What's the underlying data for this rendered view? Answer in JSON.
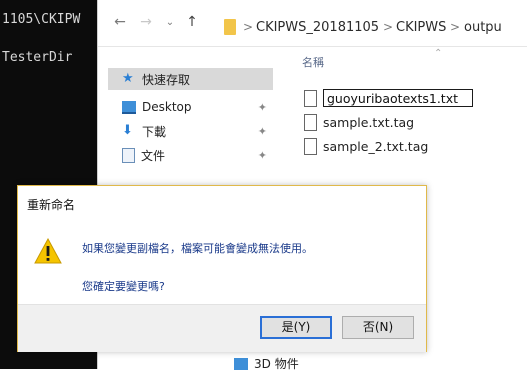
{
  "console": {
    "line1": "1105\\CKIPW",
    "line2": "TesterDir"
  },
  "address": {
    "back_icon": "back-arrow-icon",
    "forward_icon": "forward-arrow-icon",
    "dropdown_icon": "chevron-down-icon",
    "up_icon": "up-arrow-icon",
    "separator": ">",
    "crumbs": [
      "CKIPWS_20181105",
      "CKIPWS",
      "outpu"
    ]
  },
  "navpane": {
    "items": [
      {
        "label": "快速存取",
        "icon": "star-icon",
        "pinned": false
      },
      {
        "label": "Desktop",
        "icon": "desktop-folder-icon",
        "pinned": true
      },
      {
        "label": "下載",
        "icon": "download-folder-icon",
        "pinned": true
      },
      {
        "label": "文件",
        "icon": "documents-folder-icon",
        "pinned": true
      }
    ],
    "bottom_item": "3D 物件",
    "pin_glyph": "✦"
  },
  "filelist": {
    "column_name": "名稱",
    "rename_value": "guoyuribaotexts1.txt",
    "files": [
      "sample.txt.tag",
      "sample_2.txt.tag"
    ]
  },
  "dialog": {
    "title": "重新命名",
    "message": "如果您變更副檔名，檔案可能會變成無法使用。",
    "question": "您確定要變更嗎?",
    "yes_label": "是(Y)",
    "no_label": "否(N)",
    "accent_color": "#e0b94a",
    "warning_color": "#f5c400"
  }
}
